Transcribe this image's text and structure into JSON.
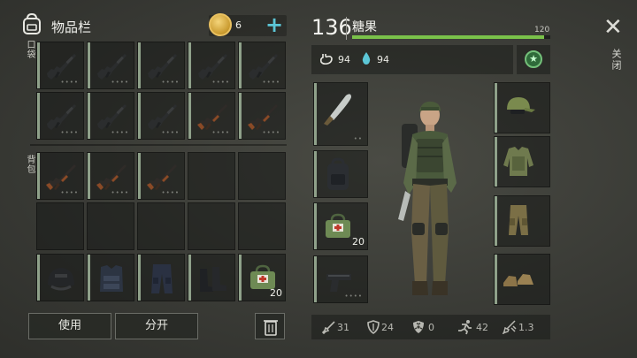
{
  "header": {
    "title": "物品栏",
    "coins": "6",
    "plus": "+"
  },
  "sections": {
    "pocket": "口袋",
    "backpack": "背包"
  },
  "item_dots": "••••",
  "grid_items": [
    {
      "type": "rifle",
      "dots": "••••"
    },
    {
      "type": "rifle",
      "dots": "••••"
    },
    {
      "type": "rifle",
      "dots": "••••"
    },
    {
      "type": "rifle",
      "dots": "••••"
    },
    {
      "type": "rifle",
      "dots": "••••"
    },
    {
      "type": "rifle",
      "dots": "••••"
    },
    {
      "type": "rifle",
      "dots": "••••"
    },
    {
      "type": "rifle",
      "dots": "••••"
    },
    {
      "type": "ak",
      "dots": "••••"
    },
    {
      "type": "ak",
      "dots": "••••"
    },
    {
      "type": "ak",
      "dots": "••••"
    },
    {
      "type": "ak",
      "dots": "••••"
    },
    {
      "type": "ak",
      "dots": "••••"
    },
    {
      "type": "empty"
    },
    {
      "type": "empty"
    },
    {
      "type": "empty"
    },
    {
      "type": "empty"
    },
    {
      "type": "empty"
    },
    {
      "type": "empty"
    },
    {
      "type": "empty"
    },
    {
      "type": "helmet"
    },
    {
      "type": "vest"
    },
    {
      "type": "pants"
    },
    {
      "type": "boots"
    },
    {
      "type": "medkit",
      "qty": "20"
    }
  ],
  "buttons": {
    "use": "使用",
    "split": "分开",
    "trash_icon": "trash-icon"
  },
  "character": {
    "level": "136",
    "name": "糖果",
    "xp_value": "120",
    "xp_fraction": 0.97,
    "hunger": "94",
    "thirst": "94",
    "star_icon": "★"
  },
  "equipment_left": [
    {
      "type": "machete",
      "dots": "••"
    },
    {
      "type": "backpack"
    },
    {
      "type": "medkit",
      "qty": "20"
    },
    {
      "type": "pistol",
      "dots": "••••"
    }
  ],
  "equipment_right": [
    {
      "type": "cap"
    },
    {
      "type": "jacket"
    },
    {
      "type": "cargo-pants"
    },
    {
      "type": "shoes"
    }
  ],
  "bottom_stats": {
    "attack": "31",
    "armor": "24",
    "radiation": "0",
    "speed": "42",
    "critical": "1.3"
  },
  "close": {
    "icon": "✕",
    "label": "关闭"
  },
  "colors": {
    "accent": "#5cc6d6",
    "xp": "#7ac24a",
    "slot_bar": "#8fa18a"
  }
}
